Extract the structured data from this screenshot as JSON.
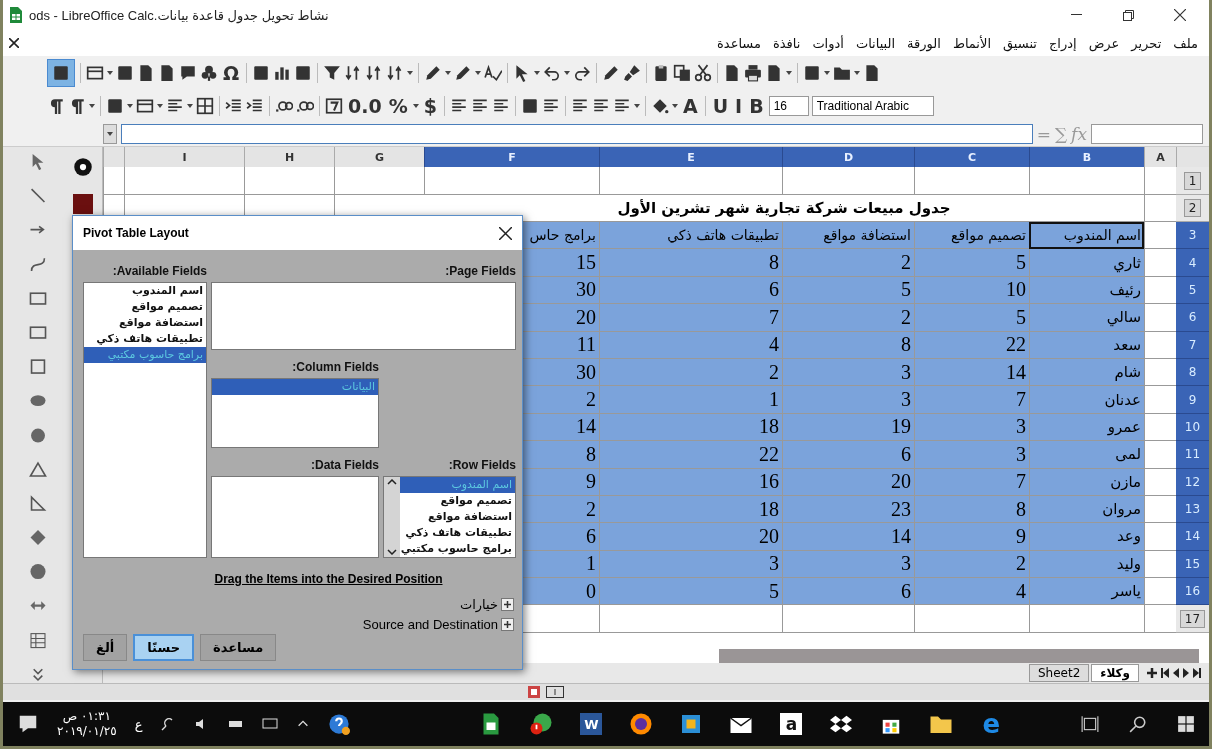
{
  "window": {
    "title": "نشاط تحويل جدول قاعدة بيانات.ods - LibreOffice Calc"
  },
  "menu": [
    "ملف",
    "تحرير",
    "عرض",
    "إدراج",
    "تنسيق",
    "الأنماط",
    "الورقة",
    "البيانات",
    "أدوات",
    "نافذة",
    "مساعدة"
  ],
  "toolbar_standard": {
    "glyphs": [
      "Ω"
    ]
  },
  "toolbar_formatting": {
    "glyphs": [
      "B",
      "I",
      "U",
      "A",
      "$",
      "%",
      "0.0"
    ],
    "font_size": "16",
    "font_name": "Traditional Arabic"
  },
  "formula_bar": {
    "glyphs": [
      "fx",
      "∑",
      "="
    ]
  },
  "columns": [
    {
      "label": "A",
      "selected": false
    },
    {
      "label": "B",
      "selected": true
    },
    {
      "label": "C",
      "selected": true
    },
    {
      "label": "D",
      "selected": true
    },
    {
      "label": "E",
      "selected": true
    },
    {
      "label": "F",
      "selected": true
    },
    {
      "label": "G",
      "selected": false
    },
    {
      "label": "H",
      "selected": false
    },
    {
      "label": "I",
      "selected": false
    }
  ],
  "rows": [
    {
      "number": "1",
      "kind": "blank",
      "selected": false,
      "active": false,
      "cells": []
    },
    {
      "number": "2",
      "kind": "title",
      "selected": false,
      "active": false,
      "cells": [
        "جدول مبيعات شركة تجارية شهر تشرين الأول"
      ]
    },
    {
      "number": "3",
      "kind": "header",
      "selected": true,
      "active": true,
      "cells": [
        "اسم المندوب",
        "تصميم مواقع",
        "استضافة مواقع",
        "تطبيقات هاتف ذكي",
        "برامج حاس"
      ]
    },
    {
      "number": "4",
      "kind": "data",
      "selected": true,
      "active": false,
      "cells": [
        "ثاري",
        "5",
        "2",
        "8",
        "15"
      ]
    },
    {
      "number": "5",
      "kind": "data",
      "selected": true,
      "active": false,
      "cells": [
        "رئيف",
        "10",
        "5",
        "6",
        "30"
      ]
    },
    {
      "number": "6",
      "kind": "data",
      "selected": true,
      "active": false,
      "cells": [
        "سالي",
        "5",
        "2",
        "7",
        "20"
      ]
    },
    {
      "number": "7",
      "kind": "data",
      "selected": true,
      "active": false,
      "cells": [
        "سعد",
        "22",
        "8",
        "4",
        "11"
      ]
    },
    {
      "number": "8",
      "kind": "data",
      "selected": true,
      "active": false,
      "cells": [
        "شام",
        "14",
        "3",
        "2",
        "30"
      ]
    },
    {
      "number": "9",
      "kind": "data",
      "selected": true,
      "active": false,
      "cells": [
        "عدنان",
        "7",
        "3",
        "1",
        "2"
      ]
    },
    {
      "number": "10",
      "kind": "data",
      "selected": true,
      "active": false,
      "cells": [
        "عمرو",
        "3",
        "19",
        "18",
        "14"
      ]
    },
    {
      "number": "11",
      "kind": "data",
      "selected": true,
      "active": false,
      "cells": [
        "لمى",
        "3",
        "6",
        "22",
        "8"
      ]
    },
    {
      "number": "12",
      "kind": "data",
      "selected": true,
      "active": false,
      "cells": [
        "مازن",
        "7",
        "20",
        "16",
        "9"
      ]
    },
    {
      "number": "13",
      "kind": "data",
      "selected": true,
      "active": false,
      "cells": [
        "مروان",
        "8",
        "23",
        "18",
        "2"
      ]
    },
    {
      "number": "14",
      "kind": "data",
      "selected": true,
      "active": false,
      "cells": [
        "وعد",
        "9",
        "14",
        "20",
        "6"
      ]
    },
    {
      "number": "15",
      "kind": "data",
      "selected": true,
      "active": false,
      "cells": [
        "وليد",
        "2",
        "3",
        "3",
        "1"
      ]
    },
    {
      "number": "16",
      "kind": "data",
      "selected": true,
      "active": false,
      "cells": [
        "ياسر",
        "4",
        "6",
        "5",
        "0"
      ]
    },
    {
      "number": "17",
      "kind": "blank",
      "selected": false,
      "active": false,
      "cells": []
    }
  ],
  "dialog": {
    "title": "Pivot Table Layout",
    "available_fields": {
      "label": ":Available Fields",
      "items": [
        {
          "label": "اسم المندوب",
          "selected": false
        },
        {
          "label": "تصميم مواقع",
          "selected": false
        },
        {
          "label": "استضافة مواقع",
          "selected": false
        },
        {
          "label": "تطبيقات هاتف ذكي",
          "selected": false
        },
        {
          "label": "برامج حاسوب مكتبي",
          "selected": true
        }
      ]
    },
    "page_fields": {
      "label": ":Page Fields"
    },
    "column_fields": {
      "label": ":Column Fields",
      "items": [
        {
          "label": "البيانات",
          "selected": true
        }
      ]
    },
    "data_fields": {
      "label": ":Data Fields"
    },
    "row_fields": {
      "label": ":Row Fields",
      "items": [
        {
          "label": "اسم المندوب",
          "selected": true
        },
        {
          "label": "تصميم مواقع",
          "selected": false
        },
        {
          "label": "استضافة مواقع",
          "selected": false
        },
        {
          "label": "تطبيقات هاتف ذكي",
          "selected": false
        },
        {
          "label": "برامج حاسوب مكتبي",
          "selected": false
        }
      ]
    },
    "hint_link": "Drag the Items into the Desired Position",
    "expanders": [
      {
        "label": "خيارات",
        "expanded": false
      },
      {
        "label": "Source and Destination",
        "expanded": false
      }
    ],
    "buttons": [
      {
        "label": "مساعدة",
        "kind": "help"
      },
      {
        "label": "حسنًا",
        "kind": "default"
      },
      {
        "label": "ألغ",
        "kind": "cancel"
      }
    ]
  },
  "sheet_tabs": [
    {
      "label": "وكلاء",
      "selected": true
    },
    {
      "label": "Sheet2",
      "selected": false
    }
  ],
  "taskbar": {
    "time": "٠١:٣١ ص",
    "date": "٢٠١٩/٠١/٢٥",
    "language": "ع",
    "app_letters": [
      "e",
      "a",
      "W"
    ]
  }
}
